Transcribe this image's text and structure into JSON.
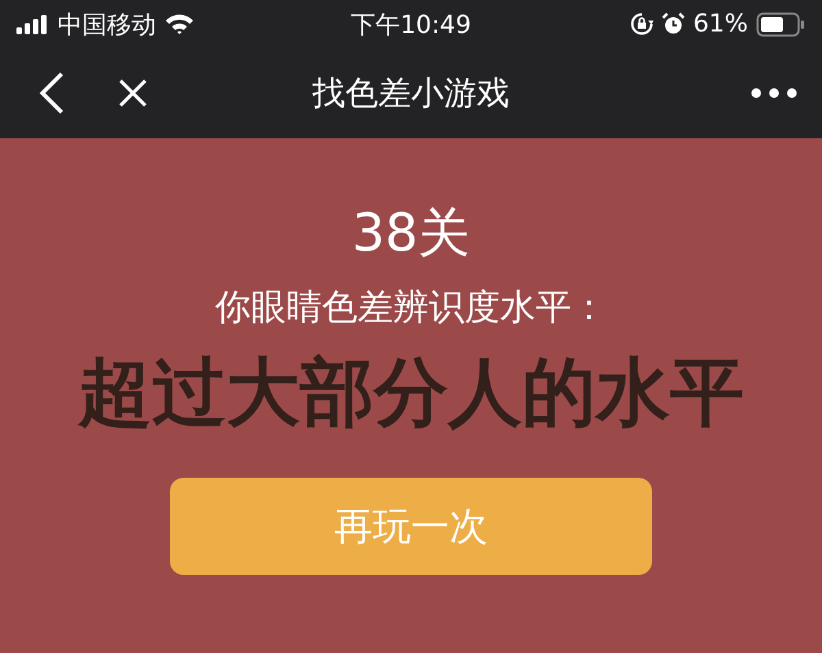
{
  "status_bar": {
    "carrier": "中国移动",
    "time": "下午10:49",
    "battery": "61%"
  },
  "nav_bar": {
    "title": "找色差小游戏"
  },
  "result": {
    "level": "38关",
    "prompt": "你眼睛色差辨识度水平：",
    "verdict": "超过大部分人的水平",
    "button": "再玩一次"
  }
}
